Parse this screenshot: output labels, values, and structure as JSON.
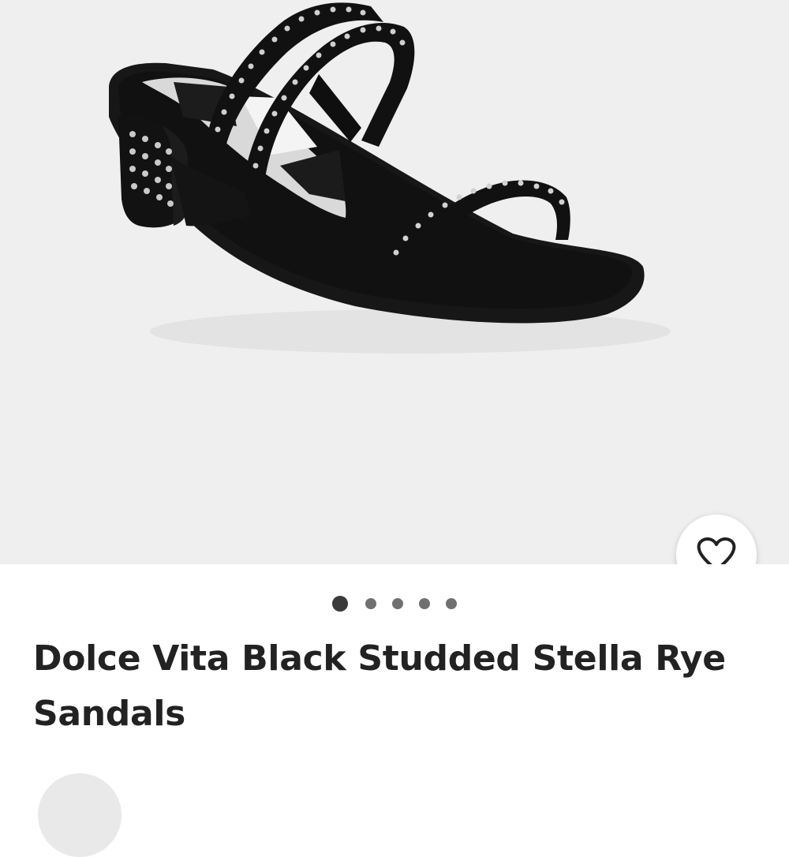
{
  "product": {
    "title": "Dolce Vita Black Studded Stella Rye Sandals"
  },
  "gallery": {
    "image_count": 5,
    "active_index": 0,
    "background_color": "#efefef"
  },
  "favorite": {
    "icon": "heart-outline-icon",
    "icon_color": "#222222"
  },
  "pagination": {
    "active_color": "#3b3b3b",
    "inactive_color": "#707070"
  }
}
